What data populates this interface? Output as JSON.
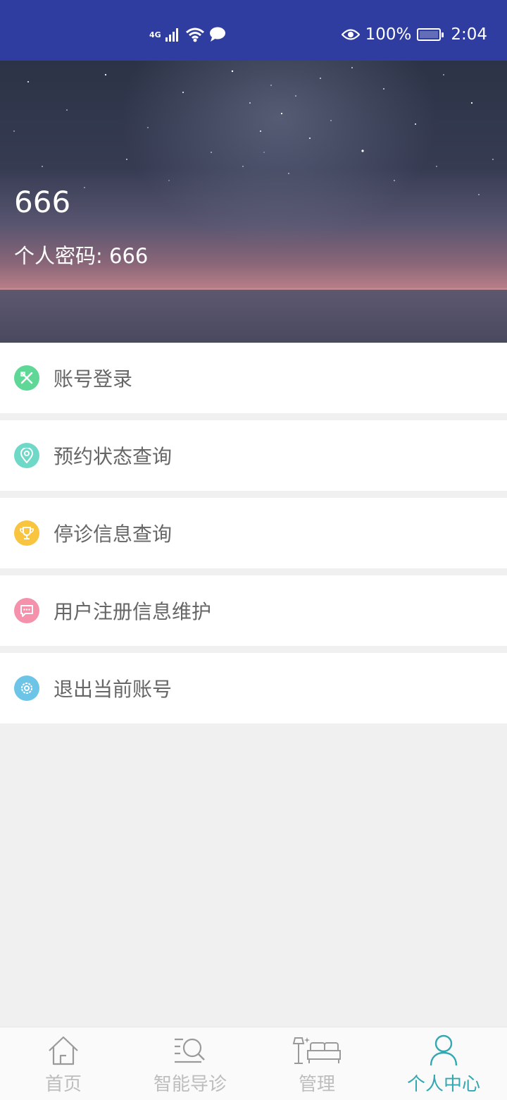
{
  "status_bar": {
    "network": "4G",
    "battery": "100%",
    "time": "2:04"
  },
  "profile": {
    "name": "666",
    "password_line": "个人密码: 666"
  },
  "menu": [
    {
      "label": "账号登录",
      "icon": "pencil-ruler-icon",
      "color": "#5fd897"
    },
    {
      "label": "预约状态查询",
      "icon": "location-pin-icon",
      "color": "#70d8c6"
    },
    {
      "label": "停诊信息查询",
      "icon": "trophy-icon",
      "color": "#f9c43f"
    },
    {
      "label": "用户注册信息维护",
      "icon": "chat-bubble-icon",
      "color": "#f591ab"
    },
    {
      "label": "退出当前账号",
      "icon": "gear-icon",
      "color": "#6cc4e6"
    }
  ],
  "tabs": [
    {
      "label": "首页",
      "icon": "home-icon"
    },
    {
      "label": "智能导诊",
      "icon": "search-list-icon"
    },
    {
      "label": "管理",
      "icon": "furniture-icon"
    },
    {
      "label": "个人中心",
      "icon": "person-icon",
      "active": true
    }
  ],
  "colors": {
    "status_bar": "#2f3da0",
    "accent": "#34a8b0",
    "tab_inactive": "#bdbdbd"
  }
}
